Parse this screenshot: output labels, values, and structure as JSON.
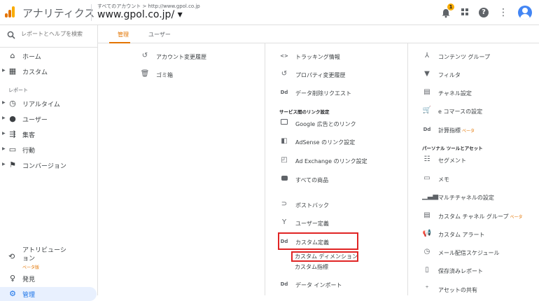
{
  "header": {
    "app_name": "アナリティクス",
    "breadcrumb": "すべてのアカウント > http://www.gpol.co.jp",
    "property": "www.gpol.co.jp/ ▾",
    "notification_count": "1"
  },
  "sidebar": {
    "search_placeholder": "レポートとヘルプを検索",
    "home": "ホーム",
    "custom": "カスタム",
    "reports_section": "レポート",
    "realtime": "リアルタイム",
    "users": "ユーザー",
    "acquisition": "集客",
    "behavior": "行動",
    "conversions": "コンバージョン",
    "attribution": "アトリビューション",
    "attribution_beta": "ベータ版",
    "discover": "発見",
    "admin": "管理"
  },
  "tabs": {
    "admin": "管理",
    "user": "ユーザー"
  },
  "account_col": {
    "change_history": "アカウント変更履歴",
    "trash": "ゴミ箱"
  },
  "property_col": {
    "tracking_info": "トラッキング情報",
    "property_change_history": "プロパティ変更履歴",
    "data_deletion": "データ削除リクエスト",
    "product_linking_head": "サービス間のリンク設定",
    "google_ads": "Google 広告とのリンク",
    "adsense": "AdSense のリンク設定",
    "ad_exchange": "Ad Exchange のリンク設定",
    "all_products": "すべての商品",
    "postbacks": "ポストバック",
    "audience_definitions": "ユーザー定義",
    "custom_definitions": "カスタム定義",
    "custom_dimensions": "カスタム ディメンション",
    "custom_metrics": "カスタム指標",
    "data_import": "データ インポート"
  },
  "view_col": {
    "content_grouping": "コンテンツ グループ",
    "filters": "フィルタ",
    "channel_settings": "チャネル設定",
    "ecommerce": "e コマースの設定",
    "calculated_metrics": "計算指標",
    "calculated_beta": "ベータ",
    "personal_tools_head": "パーソナル ツールとアセット",
    "segments": "セグメント",
    "annotations": "メモ",
    "mcf_settings": "マルチチャネルの設定",
    "custom_channel_grouping": "カスタム チャネル グループ",
    "custom_channel_beta": "ベータ",
    "custom_alerts": "カスタム アラート",
    "scheduled_emails": "メール配信スケジュール",
    "saved_reports": "保存済みレポート",
    "share_assets": "アセットの共有"
  },
  "colors": {
    "accent": "#e37400",
    "highlight_border": "#e02424",
    "active_blue": "#1a73e8"
  }
}
